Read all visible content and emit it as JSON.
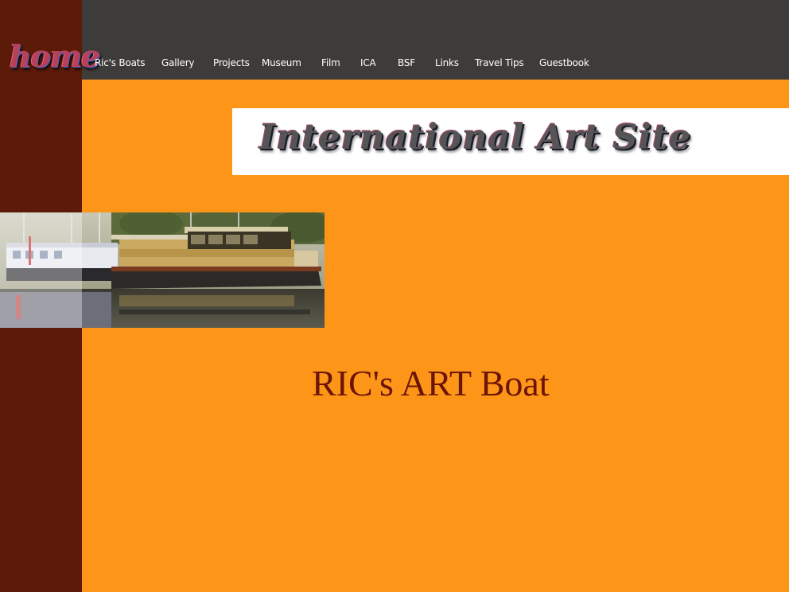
{
  "logo": {
    "label": "home"
  },
  "nav": {
    "items": [
      {
        "label": "Ric's Boats"
      },
      {
        "label": "Gallery"
      },
      {
        "label": "Projects"
      },
      {
        "label": "Museum"
      },
      {
        "label": "Film"
      },
      {
        "label": "ICA"
      },
      {
        "label": "BSF"
      },
      {
        "label": "Links"
      },
      {
        "label": "Travel Tips"
      },
      {
        "label": "Guestbook"
      }
    ]
  },
  "banner": {
    "text": "International Art Site"
  },
  "main": {
    "title": "RIC's ART Boat"
  },
  "colors": {
    "page_background": "#fd9518",
    "sidebar": "#5c1a08",
    "topbar": "#3e3c3a",
    "title_text": "#6b1408"
  },
  "icons": {
    "photo": "houseboat-photo"
  }
}
